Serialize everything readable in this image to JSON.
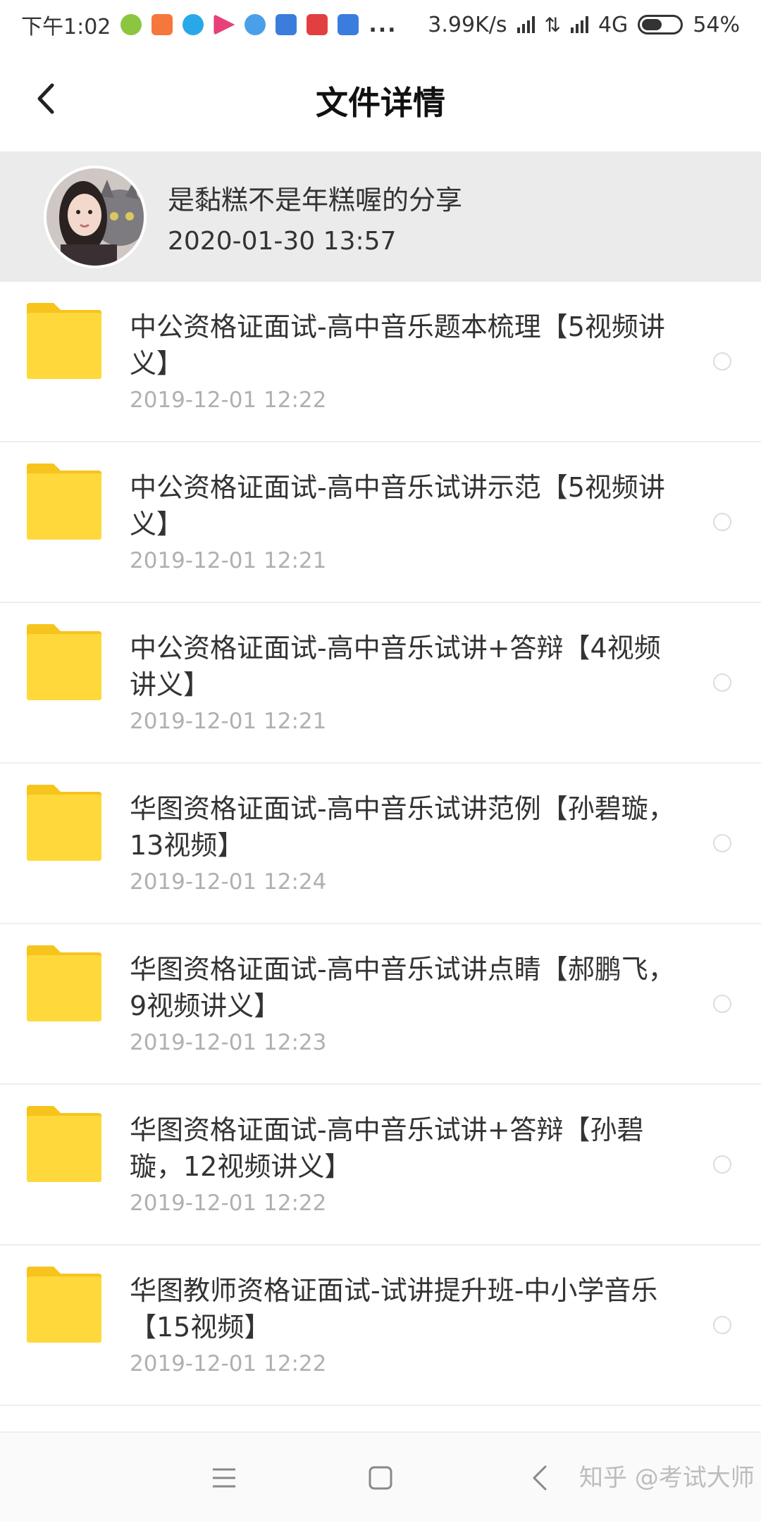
{
  "status_bar": {
    "time": "下午1:02",
    "notification_icons": [
      {
        "name": "wechat-icon",
        "color": "#8cc63f"
      },
      {
        "name": "taobao-icon",
        "color": "#f5773c"
      },
      {
        "name": "browser-icon",
        "color": "#28a8e8"
      },
      {
        "name": "video-icon",
        "color": "#e8407a"
      },
      {
        "name": "qq-browser-icon",
        "color": "#4aa0e8"
      },
      {
        "name": "tieba-icon",
        "color": "#3b7ddd"
      },
      {
        "name": "news-icon",
        "color": "#e24040"
      },
      {
        "name": "tieba-icon-2",
        "color": "#3b7ddd"
      }
    ],
    "more": "...",
    "network_speed": "3.99K/s",
    "network_type": "4G",
    "battery": "54%",
    "battery_level": 0.54
  },
  "header": {
    "title": "文件详情",
    "back_icon": "chevron-left-icon"
  },
  "share": {
    "owner_text": "是黏糕不是年糕喔的分享",
    "time": "2020-01-30  13:57"
  },
  "files": [
    {
      "name": "中公资格证面试-高中音乐题本梳理【5视频讲义】",
      "date": "2019-12-01  12:22"
    },
    {
      "name": "中公资格证面试-高中音乐试讲示范【5视频讲义】",
      "date": "2019-12-01  12:21"
    },
    {
      "name": "中公资格证面试-高中音乐试讲+答辩【4视频讲义】",
      "date": "2019-12-01  12:21"
    },
    {
      "name": "华图资格证面试-高中音乐试讲范例【孙碧璇，13视频】",
      "date": "2019-12-01  12:24"
    },
    {
      "name": "华图资格证面试-高中音乐试讲点睛【郝鹏飞，9视频讲义】",
      "date": "2019-12-01  12:23"
    },
    {
      "name": "华图资格证面试-高中音乐试讲+答辩【孙碧璇，12视频讲义】",
      "date": "2019-12-01  12:22"
    },
    {
      "name": "华图教师资格证面试-试讲提升班-中小学音乐【15视频】",
      "date": "2019-12-01  12:22"
    }
  ],
  "colors": {
    "folder": "#ffd83c",
    "folder_tab": "#f6c41c",
    "banner_bg": "#ebebeb",
    "date_text": "#b0b0b0"
  },
  "nav_bar": {
    "menu_icon": "menu-icon",
    "home_icon": "square-home-icon",
    "back_icon": "back-triangle-icon"
  },
  "watermark": "知乎 @考试大师"
}
